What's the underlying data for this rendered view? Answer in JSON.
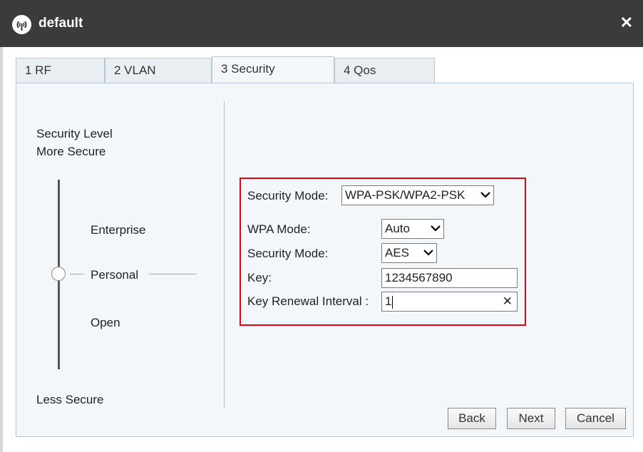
{
  "window": {
    "title": "default"
  },
  "tabs": [
    {
      "label": "1 RF"
    },
    {
      "label": "2 VLAN"
    },
    {
      "label": "3 Security",
      "active": true
    },
    {
      "label": "4 Qos"
    }
  ],
  "security_level": {
    "heading_line1": "Security Level",
    "heading_line2": "More Secure",
    "levels": [
      "Enterprise",
      "Personal",
      "Open"
    ],
    "selected": "Personal",
    "bottom": "Less Secure"
  },
  "form": {
    "security_mode_label": "Security Mode:",
    "security_mode_value": "WPA-PSK/WPA2-PSK",
    "wpa_mode_label": "WPA Mode:",
    "wpa_mode_value": "Auto",
    "encryption_label": "Security Mode:",
    "encryption_value": "AES",
    "key_label": "Key:",
    "key_value": "1234567890",
    "renewal_label": "Key Renewal Interval :",
    "renewal_value": "1"
  },
  "buttons": {
    "back": "Back",
    "next": "Next",
    "cancel": "Cancel"
  },
  "colors": {
    "titlebar": "#3b3b3b",
    "highlight": "#e60012",
    "panel": "#f4f7fa"
  }
}
